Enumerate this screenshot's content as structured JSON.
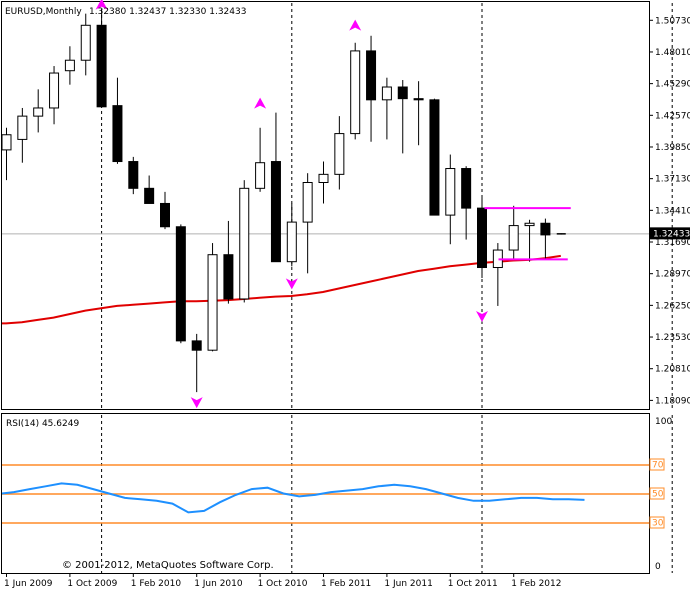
{
  "chart_data": [
    {
      "type": "candlestick",
      "symbol_label": "EURUSD,Monthly",
      "ohlc_label": "1.32380 1.32437 1.32330 1.32433",
      "current_price": "1.32433",
      "copyright": "© 2001-2012, MetaQuotes Software Corp.",
      "price_ticks": [
        "1.50730",
        "1.48010",
        "1.45290",
        "1.42570",
        "1.39850",
        "1.37130",
        "1.34410",
        "1.31690",
        "1.28970",
        "1.26250",
        "1.23530",
        "1.20810",
        "1.18090"
      ],
      "ylim": [
        1.1735,
        1.523
      ],
      "time_labels": [
        "1 Jun 2009",
        "1 Oct 2009",
        "1 Feb 2010",
        "1 Jun 2010",
        "1 Oct 2010",
        "1 Feb 2011",
        "1 Jun 2011",
        "1 Oct 2011",
        "1 Feb 2012"
      ],
      "candles": [
        {
          "o": 1.396,
          "h": 1.415,
          "l": 1.37,
          "c": 1.409
        },
        {
          "o": 1.405,
          "h": 1.432,
          "l": 1.385,
          "c": 1.425
        },
        {
          "o": 1.425,
          "h": 1.448,
          "l": 1.411,
          "c": 1.432
        },
        {
          "o": 1.432,
          "h": 1.468,
          "l": 1.418,
          "c": 1.462
        },
        {
          "o": 1.464,
          "h": 1.485,
          "l": 1.452,
          "c": 1.473
        },
        {
          "o": 1.473,
          "h": 1.513,
          "l": 1.46,
          "c": 1.503
        },
        {
          "o": 1.503,
          "h": 1.515,
          "l": 1.435,
          "c": 1.433
        },
        {
          "o": 1.434,
          "h": 1.458,
          "l": 1.384,
          "c": 1.386
        },
        {
          "o": 1.386,
          "h": 1.39,
          "l": 1.358,
          "c": 1.363
        },
        {
          "o": 1.363,
          "h": 1.374,
          "l": 1.35,
          "c": 1.35
        },
        {
          "o": 1.35,
          "h": 1.36,
          "l": 1.328,
          "c": 1.33
        },
        {
          "o": 1.33,
          "h": 1.332,
          "l": 1.23,
          "c": 1.232
        },
        {
          "o": 1.232,
          "h": 1.238,
          "l": 1.188,
          "c": 1.224
        },
        {
          "o": 1.224,
          "h": 1.316,
          "l": 1.223,
          "c": 1.306
        },
        {
          "o": 1.306,
          "h": 1.335,
          "l": 1.264,
          "c": 1.268
        },
        {
          "o": 1.268,
          "h": 1.37,
          "l": 1.265,
          "c": 1.363
        },
        {
          "o": 1.363,
          "h": 1.415,
          "l": 1.36,
          "c": 1.385
        },
        {
          "o": 1.386,
          "h": 1.428,
          "l": 1.308,
          "c": 1.3
        },
        {
          "o": 1.3,
          "h": 1.35,
          "l": 1.296,
          "c": 1.334
        },
        {
          "o": 1.334,
          "h": 1.376,
          "l": 1.29,
          "c": 1.368
        },
        {
          "o": 1.368,
          "h": 1.386,
          "l": 1.35,
          "c": 1.375
        },
        {
          "o": 1.375,
          "h": 1.425,
          "l": 1.362,
          "c": 1.41
        },
        {
          "o": 1.41,
          "h": 1.488,
          "l": 1.405,
          "c": 1.481
        },
        {
          "o": 1.481,
          "h": 1.494,
          "l": 1.403,
          "c": 1.439
        },
        {
          "o": 1.439,
          "h": 1.458,
          "l": 1.405,
          "c": 1.45
        },
        {
          "o": 1.45,
          "h": 1.456,
          "l": 1.393,
          "c": 1.44
        },
        {
          "o": 1.44,
          "h": 1.455,
          "l": 1.4,
          "c": 1.439
        },
        {
          "o": 1.439,
          "h": 1.44,
          "l": 1.346,
          "c": 1.34
        },
        {
          "o": 1.34,
          "h": 1.392,
          "l": 1.315,
          "c": 1.38
        },
        {
          "o": 1.38,
          "h": 1.382,
          "l": 1.319,
          "c": 1.346
        },
        {
          "o": 1.346,
          "h": 1.356,
          "l": 1.286,
          "c": 1.295
        },
        {
          "o": 1.295,
          "h": 1.316,
          "l": 1.262,
          "c": 1.31
        },
        {
          "o": 1.31,
          "h": 1.348,
          "l": 1.302,
          "c": 1.331
        },
        {
          "o": 1.331,
          "h": 1.336,
          "l": 1.3,
          "c": 1.333
        },
        {
          "o": 1.333,
          "h": 1.337,
          "l": 1.302,
          "c": 1.323
        },
        {
          "o": 1.3238,
          "h": 1.32437,
          "l": 1.3233,
          "c": 1.32433
        }
      ],
      "moving_average": [
        1.247,
        1.248,
        1.25,
        1.252,
        1.255,
        1.258,
        1.26,
        1.262,
        1.263,
        1.264,
        1.265,
        1.266,
        1.266,
        1.2665,
        1.267,
        1.268,
        1.269,
        1.27,
        1.2705,
        1.272,
        1.274,
        1.277,
        1.28,
        1.283,
        1.286,
        1.289,
        1.292,
        1.294,
        1.296,
        1.2975,
        1.299,
        1.3,
        1.301,
        1.3015,
        1.303,
        1.305
      ],
      "fractals_up": [
        {
          "i": 6,
          "price": 1.513
        },
        {
          "i": 16,
          "price": 1.428
        },
        {
          "i": 22,
          "price": 1.495
        }
      ],
      "fractals_down": [
        {
          "i": 12,
          "price": 1.188
        },
        {
          "i": 18,
          "price": 1.29
        },
        {
          "i": 30,
          "price": 1.262
        }
      ],
      "box": {
        "from": 30,
        "to": 35,
        "top": 1.346,
        "bottom": 1.302
      },
      "vertical_lines_at": [
        6,
        18,
        30,
        42
      ],
      "colors": {
        "bull": "#ffffff",
        "bear": "#000000",
        "ma": "#e00000",
        "fractal": "#ff00ff",
        "rsi": "#1e90ff",
        "rsi_level": "#ff8c28"
      }
    },
    {
      "type": "line",
      "title": "RSI(14) 45.6249",
      "ylim": [
        0,
        100
      ],
      "yticks": [
        "100",
        "0"
      ],
      "levels": [
        "70",
        "50",
        "30"
      ],
      "values": [
        50,
        51,
        53,
        55,
        57,
        56,
        53,
        50,
        47,
        46,
        45,
        43,
        37,
        38,
        44,
        49,
        53,
        54,
        50,
        48,
        49,
        51,
        52,
        53,
        55,
        56,
        55,
        53,
        50,
        47,
        45,
        45,
        46,
        47,
        47,
        46,
        46,
        45.6
      ]
    }
  ]
}
